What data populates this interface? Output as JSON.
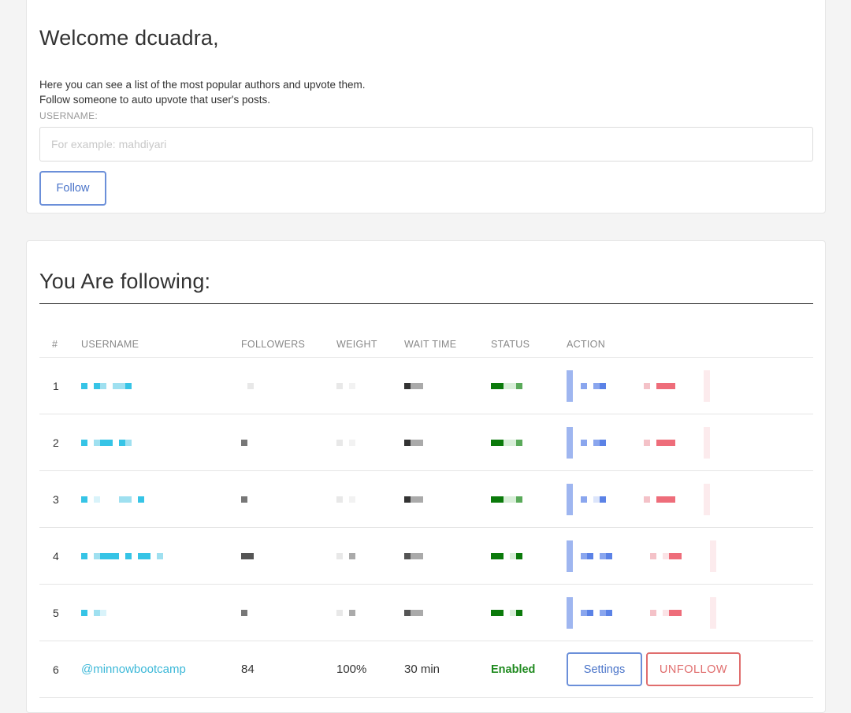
{
  "welcome": {
    "title": "Welcome dcuadra,",
    "intro_line1": "Here you can see a list of the most popular authors and upvote them.",
    "intro_line2": "Follow someone to auto upvote that user's posts.",
    "username_label": "USERNAME:",
    "username_placeholder": "For example: mahdiyari",
    "username_value": "",
    "follow_button": "Follow"
  },
  "following": {
    "title": "You Are following:",
    "columns": [
      "#",
      "USERNAME",
      "FOLLOWERS",
      "WEIGHT",
      "WAIT TIME",
      "STATUS",
      "ACTION"
    ],
    "pixelated_rows": [
      "1",
      "2",
      "3",
      "4",
      "5"
    ],
    "rows": [
      {
        "num": "6",
        "username": "@minnowbootcamp",
        "followers": "84",
        "weight": "100%",
        "wait_time": "30 min",
        "status": "Enabled",
        "settings_label": "Settings",
        "unfollow_label": "UNFOLLOW"
      }
    ]
  },
  "colors": {
    "accent_blue": "#6b8fd9",
    "username_cyan": "#3cb8d8",
    "status_green": "#1f8a1f",
    "unfollow_red": "#e06d6d"
  }
}
